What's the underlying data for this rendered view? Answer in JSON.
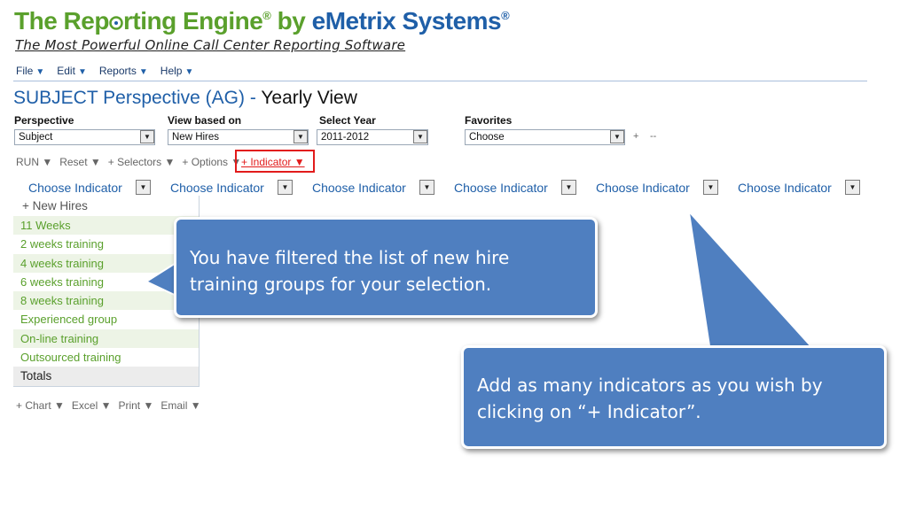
{
  "logo": {
    "part1": "The Rep",
    "part2": "rting Engine",
    "reg1": "®",
    "part3": " by ",
    "part4": "eMetrix Systems",
    "reg2": "®",
    "tagline": "The Most Powerful Online Call Center Reporting Software"
  },
  "menu": [
    {
      "label": "File"
    },
    {
      "label": "Edit"
    },
    {
      "label": "Reports"
    },
    {
      "label": "Help"
    }
  ],
  "menu_arrow": "▼",
  "title": {
    "subject": "SUBJECT Perspective (AG) -",
    "view": "Yearly View"
  },
  "selectors": {
    "perspective": {
      "label": "Perspective",
      "value": "Subject"
    },
    "view_based_on": {
      "label": "View based on",
      "value": "New Hires"
    },
    "select_year": {
      "label": "Select Year",
      "value": "2011-2012"
    },
    "favorites": {
      "label": "Favorites",
      "value": "Choose",
      "plus": "+",
      "minus": "--"
    }
  },
  "toolbar": {
    "run": "RUN ▼",
    "reset": "Reset ▼",
    "selectors": "+ Selectors ▼",
    "options": "+ Options ▼",
    "indicator": "+ Indicator ▼"
  },
  "indicators": [
    "Choose Indicator",
    "Choose Indicator",
    "Choose Indicator",
    "Choose Indicator",
    "Choose Indicator",
    "Choose Indicator"
  ],
  "groups": {
    "header": "+ New Hires",
    "items": [
      "11 Weeks",
      "2 weeks training",
      "4 weeks training",
      "6 weeks training",
      "8 weeks training",
      "Experienced group",
      "On-line training",
      "Outsourced training"
    ],
    "total": "Totals"
  },
  "bottombar": {
    "chart": "+ Chart ▼",
    "excel": "Excel ▼",
    "print": "Print ▼",
    "email": "Email ▼"
  },
  "callouts": {
    "left": "You have filtered the list of new hire training groups for your selection.",
    "right": "Add as many indicators as you wish by clicking on “+ Indicator”."
  },
  "colors": {
    "brand_blue": "#1f5fa8",
    "brand_green": "#5aa02c",
    "callout_fill": "#4f7fc0",
    "highlight_red": "#e21b1b"
  }
}
